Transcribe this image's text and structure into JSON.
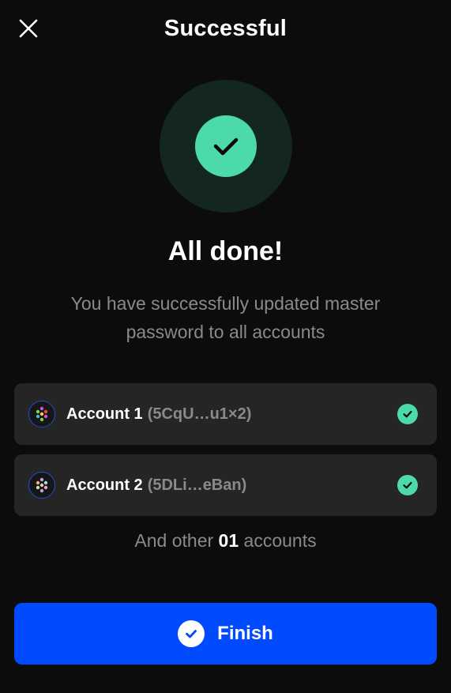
{
  "header": {
    "title": "Successful",
    "close_icon": "close-icon"
  },
  "status": {
    "icon": "check-circle-icon",
    "accent": "#4cd9ac",
    "title": "All done!",
    "description": "You have successfully updated master password to all accounts"
  },
  "accounts": [
    {
      "name": "Account 1",
      "address": "(5CqU…u1×2)",
      "status_icon": "check-icon"
    },
    {
      "name": "Account 2",
      "address": "(5DLi…eBan)",
      "status_icon": "check-icon"
    }
  ],
  "other_accounts": {
    "prefix": "And other",
    "count": "01",
    "suffix": "accounts"
  },
  "footer": {
    "finish_label": "Finish",
    "finish_icon": "check-circle-icon",
    "button_color": "#004bff"
  }
}
